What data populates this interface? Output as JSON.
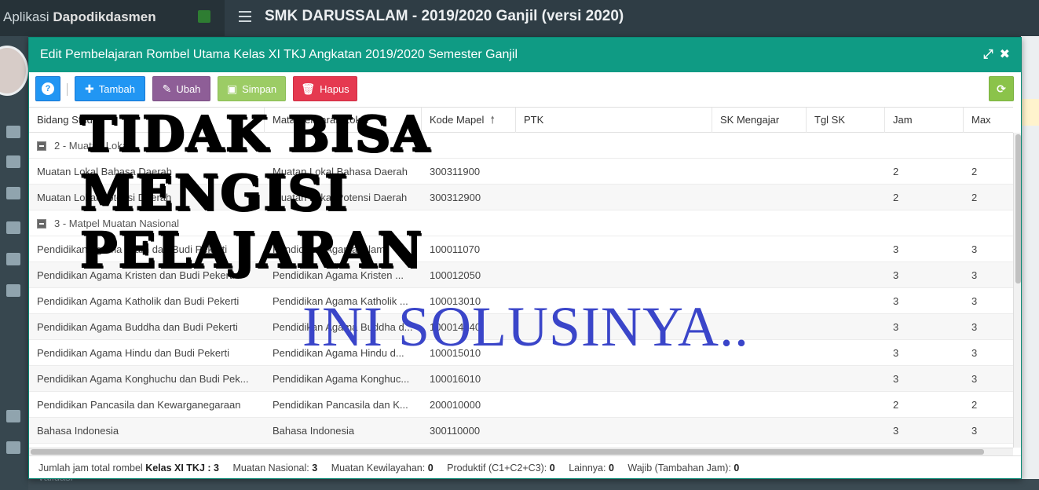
{
  "app": {
    "brand_prefix": "Aplikasi",
    "brand_name": "Dapodikdasmen",
    "title": "SMK DARUSSALAM - 2019/2020 Ganjil (versi 2020)",
    "sidebar_bottom_label": "Validasi"
  },
  "modal": {
    "title": "Edit Pembelajaran Rombel Utama Kelas XI TKJ Angkatan 2019/2020 Semester Ganjil",
    "maximize_icon": "expand-icon",
    "close_icon": "close-icon"
  },
  "toolbar": {
    "help_label": "?",
    "add_label": "Tambah",
    "edit_label": "Ubah",
    "save_label": "Simpan",
    "delete_label": "Hapus"
  },
  "grid": {
    "columns": [
      "Bidang Studi",
      "Mata Pelajaran Lokal",
      "Kode Mapel",
      "PTK",
      "SK Mengajar",
      "Tgl SK",
      "Jam",
      "Max"
    ],
    "groups": [
      {
        "label": "2 - Muatan Lokal",
        "rows": [
          {
            "bidang": "Muatan Lokal Bahasa Daerah",
            "mapel": "Muatan Lokal Bahasa Daerah",
            "kode": "300311900",
            "ptk": "",
            "sk": "",
            "tgl": "",
            "jam": "2",
            "max": "2"
          },
          {
            "bidang": "Muatan Lokal Potensi Daerah",
            "mapel": "Muatan Lokal Potensi Daerah",
            "kode": "300312900",
            "ptk": "",
            "sk": "",
            "tgl": "",
            "jam": "2",
            "max": "2"
          }
        ]
      },
      {
        "label": "3 - Matpel Muatan Nasional",
        "rows": [
          {
            "bidang": "Pendidikan Agama Islam dan Budi Pekerti",
            "mapel": "Pendidikan Agama Islam",
            "kode": "100011070",
            "ptk": "",
            "sk": "",
            "tgl": "",
            "jam": "3",
            "max": "3"
          },
          {
            "bidang": "Pendidikan Agama Kristen dan Budi Pekerti",
            "mapel": "Pendidikan Agama Kristen ...",
            "kode": "100012050",
            "ptk": "",
            "sk": "",
            "tgl": "",
            "jam": "3",
            "max": "3"
          },
          {
            "bidang": "Pendidikan Agama Katholik dan Budi Pekerti",
            "mapel": "Pendidikan Agama Katholik ...",
            "kode": "100013010",
            "ptk": "",
            "sk": "",
            "tgl": "",
            "jam": "3",
            "max": "3"
          },
          {
            "bidang": "Pendidikan Agama Buddha dan Budi Pekerti",
            "mapel": "Pendidikan Agama Buddha d...",
            "kode": "100014140",
            "ptk": "",
            "sk": "",
            "tgl": "",
            "jam": "3",
            "max": "3"
          },
          {
            "bidang": "Pendidikan Agama Hindu dan Budi Pekerti",
            "mapel": "Pendidikan Agama Hindu d...",
            "kode": "100015010",
            "ptk": "",
            "sk": "",
            "tgl": "",
            "jam": "3",
            "max": "3"
          },
          {
            "bidang": "Pendidikan Agama Konghuchu dan Budi Pek...",
            "mapel": "Pendidikan Agama Konghuc...",
            "kode": "100016010",
            "ptk": "",
            "sk": "",
            "tgl": "",
            "jam": "3",
            "max": "3"
          },
          {
            "bidang": "Pendidikan Pancasila dan Kewarganegaraan",
            "mapel": "Pendidikan Pancasila dan K...",
            "kode": "200010000",
            "ptk": "",
            "sk": "",
            "tgl": "",
            "jam": "2",
            "max": "2"
          },
          {
            "bidang": "Bahasa Indonesia",
            "mapel": "Bahasa Indonesia",
            "kode": "300110000",
            "ptk": "",
            "sk": "",
            "tgl": "",
            "jam": "3",
            "max": "3"
          }
        ]
      }
    ]
  },
  "footer": {
    "total_label": "Jumlah jam total rombel",
    "total_class": "Kelas XI TKJ",
    "total_value": ": 3",
    "nasional_label": "Muatan Nasional:",
    "nasional_value": "3",
    "kewilayahan_label": "Muatan Kewilayahan:",
    "kewilayahan_value": "0",
    "produktif_label": "Produktif (C1+C2+C3):",
    "produktif_value": "0",
    "lainnya_label": "Lainnya:",
    "lainnya_value": "0",
    "wajib_label": "Wajib (Tambahan Jam):",
    "wajib_value": "0"
  },
  "overlay": {
    "line1": "TIDAK BISA",
    "line2": "MENGISI",
    "line3": "PELAJARAN",
    "solution": "INI SOLUSINYA.."
  },
  "colors": {
    "header_teal": "#0f9b84",
    "add_blue": "#2196f3",
    "edit_purple": "#8e5e97",
    "save_green": "#9ccc65",
    "delete_red": "#e53950",
    "refresh_green": "#8bc34a",
    "overlay_blue": "#3a45c9"
  }
}
